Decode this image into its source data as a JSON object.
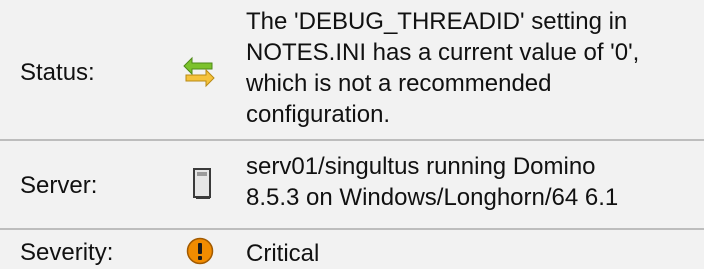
{
  "rows": [
    {
      "label": "Status:",
      "icon": "sync-arrows-icon",
      "value": "The 'DEBUG_THREADID' setting in\nNOTES.INI has a current value of '0',\nwhich is not a recommended\nconfiguration."
    },
    {
      "label": "Server:",
      "icon": "server-icon",
      "value": "serv01/singultus running Domino\n8.5.3 on Windows/Longhorn/64 6.1"
    },
    {
      "label": "Severity:",
      "icon": "critical-warning-icon",
      "value": "Critical"
    }
  ],
  "colors": {
    "row_bg": "#f2f2f2",
    "separator": "#bdbdbd",
    "critical": "#f28c00",
    "sync_green": "#7cc22c",
    "sync_yellow": "#f5c23b"
  }
}
